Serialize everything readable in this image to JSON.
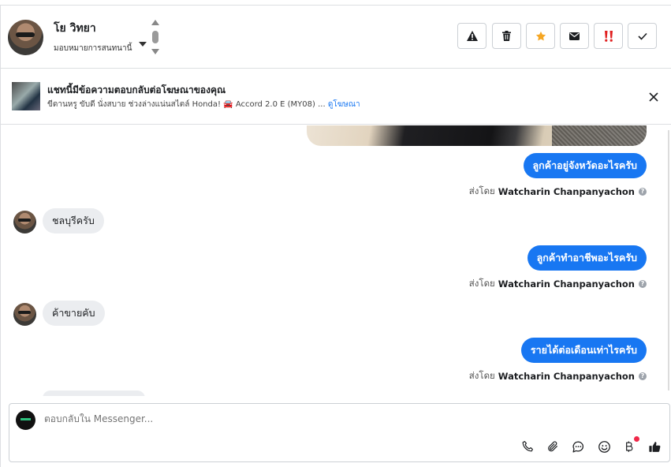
{
  "header": {
    "contact_name": "โย วิทยา",
    "assign_label": "มอบหมายการสนทนานี้",
    "actions": [
      {
        "name": "report-spam-button",
        "icon": "warning-icon"
      },
      {
        "name": "delete-button",
        "icon": "trash-icon"
      },
      {
        "name": "star-button",
        "icon": "star-icon",
        "color": "#f5a623"
      },
      {
        "name": "mark-unread-button",
        "icon": "envelope-icon"
      },
      {
        "name": "follow-up-button",
        "icon": "double-exclamation-icon",
        "color": "#e02020"
      },
      {
        "name": "mark-done-button",
        "icon": "checkmark-icon"
      }
    ]
  },
  "ad_banner": {
    "title": "แชทนี้มีข้อความตอบกลับต่อโฆษณาของคุณ",
    "description": "ขีดานหรู ขับดี นั่งสบาย ช่วงล่างแน่นสไตล์ Honda! 🚘 Accord 2.0 E (MY08) ...",
    "link_label": "ดูโฆษณา"
  },
  "messages": [
    {
      "direction": "out",
      "text": "ลูกค้าอยู่จังหวัดอะไรครับ",
      "sent_prefix": "ส่งโดย",
      "sender": "Watcharin Chanpanyachon"
    },
    {
      "direction": "in",
      "text": "ชลบุรีครับ"
    },
    {
      "direction": "out",
      "text": "ลูกค้าทำอาชีพอะไรครับ",
      "sent_prefix": "ส่งโดย",
      "sender": "Watcharin Chanpanyachon"
    },
    {
      "direction": "in",
      "text": "ค้าขายคับ"
    },
    {
      "direction": "out",
      "text": "รายได้ต่อเดือนเท่าไรครับ",
      "sent_prefix": "ส่งโดย",
      "sender": "Watcharin Chanpanyachon"
    }
  ],
  "composer": {
    "placeholder": "ตอบกลับใน Messenger...",
    "tools": [
      "phone-icon",
      "paperclip-icon",
      "chat-bubble-icon",
      "smiley-icon",
      "baht-icon",
      "thumbs-up-icon"
    ]
  },
  "colors": {
    "accent": "#1877f2",
    "incoming_bubble": "#ebedf0",
    "notification_dot": "#f02849"
  }
}
